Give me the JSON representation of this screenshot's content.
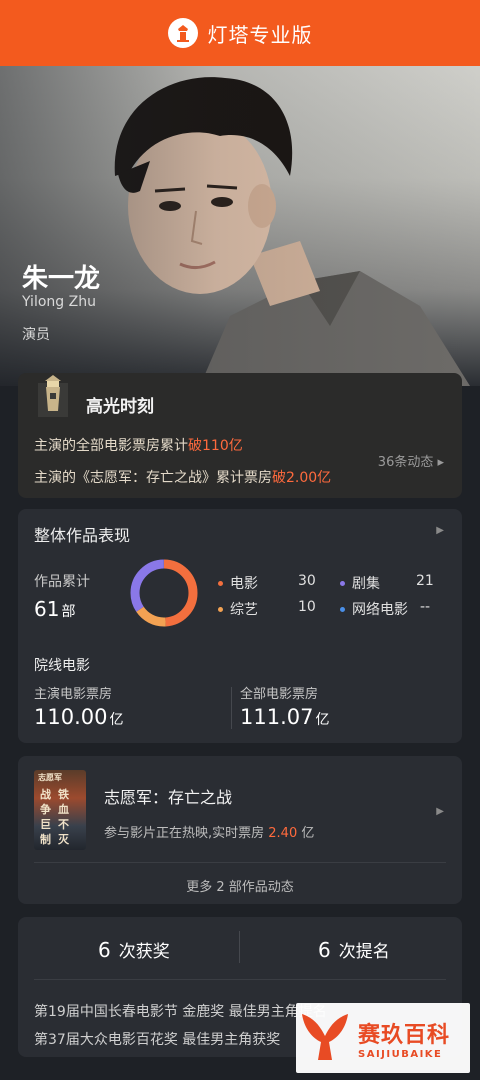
{
  "header": {
    "title": "灯塔专业版"
  },
  "profile": {
    "name": "朱一龙",
    "name_en": "Yilong Zhu",
    "role": "演员"
  },
  "highlights": {
    "title": "高光时刻",
    "line1_prefix": "主演的全部电影票房累计",
    "line1_hot": "破110亿",
    "line2_prefix": "主演的《志愿军：存亡之战》累计票房",
    "line2_hot": "破2.00亿",
    "more": "36条动态 ▸"
  },
  "overall": {
    "title": "整体作品表现",
    "total_label": "作品累计",
    "total_value": "61",
    "total_unit": "部",
    "categories": [
      {
        "label": "电影",
        "value": "30",
        "color": "#f36f3e"
      },
      {
        "label": "剧集",
        "value": "21",
        "color": "#8a78e8"
      },
      {
        "label": "综艺",
        "value": "10",
        "color": "#f3a253"
      },
      {
        "label": "网络电影",
        "value": "--",
        "color": "#4a8fe8"
      }
    ],
    "cinema_title": "院线电影",
    "lead_box_label": "主演电影票房",
    "lead_box_value": "110.00",
    "lead_box_unit": "亿",
    "all_box_label": "全部电影票房",
    "all_box_value": "111.07",
    "all_box_unit": "亿"
  },
  "movie": {
    "title": "志愿军：存亡之战",
    "desc_prefix": "参与影片正在热映,实时票房",
    "desc_value": "2.40",
    "desc_unit": "亿",
    "more": "更多 2 部作品动态",
    "poster_tag": "志愿军",
    "poster_chars": [
      "战",
      "铁",
      "争",
      "血",
      "巨",
      "不",
      "制",
      "灭"
    ]
  },
  "awards": {
    "wins_num": "6",
    "wins_label": "次获奖",
    "noms_num": "6",
    "noms_label": "次提名",
    "line1": "第19届中国长春电影节 金鹿奖 最佳男主角提名",
    "line2": "第37届大众电影百花奖 最佳男主角获奖"
  },
  "watermark": {
    "cn": "赛玖百科",
    "en": "SAIJIUBAIKE"
  }
}
